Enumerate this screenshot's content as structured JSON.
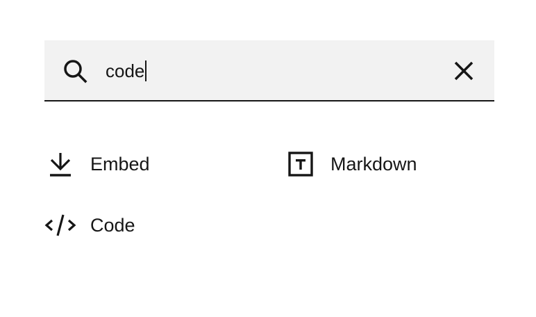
{
  "search": {
    "value": "code",
    "icon": "search-icon",
    "clear_icon": "close-icon"
  },
  "results": [
    {
      "label": "Embed",
      "icon": "download-icon"
    },
    {
      "label": "Markdown",
      "icon": "text-box-icon"
    },
    {
      "label": "Code",
      "icon": "code-icon"
    }
  ]
}
